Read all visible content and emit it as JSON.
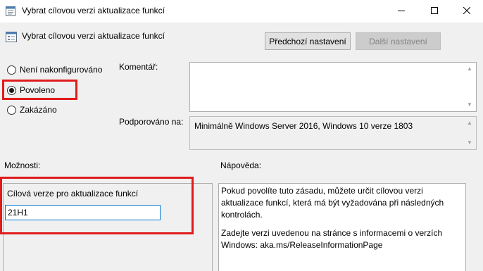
{
  "window": {
    "title": "Vybrat cílovou verzi aktualizace funkcí",
    "minimize_icon": "minimize-icon",
    "maximize_icon": "maximize-icon",
    "close_icon": "close-icon"
  },
  "header": {
    "title": "Vybrat cílovou verzi aktualizace funkcí",
    "icon": "policy-setting-icon",
    "prev_button": "Předchozí nastavení",
    "next_button": "Další nastavení"
  },
  "state": {
    "options": [
      {
        "label": "Není nakonfigurováno",
        "selected": false
      },
      {
        "label": "Povoleno",
        "selected": true
      },
      {
        "label": "Zakázáno",
        "selected": false
      }
    ]
  },
  "comment": {
    "label": "Komentář:",
    "value": ""
  },
  "supported": {
    "label": "Podporováno na:",
    "value": "Minimálně Windows Server 2016, Windows 10 verze 1803"
  },
  "options_section": {
    "label": "Možnosti:",
    "field_label": "Cílová verze pro aktualizace funkcí",
    "field_value": "21H1"
  },
  "help_section": {
    "label": "Nápověda:",
    "paragraph1": "Pokud povolíte tuto zásadu, můžete určit cílovou verzi aktualizace funkcí, která má být vyžadována při následných kontrolách.",
    "paragraph2": "Zadejte verzi uvedenou na stránce s informacemi o verzích Windows: aka.ms/ReleaseInformationPage"
  },
  "colors": {
    "highlight": "#e01b1b",
    "input_focus": "#0078d7",
    "background": "#f0f0f0"
  }
}
